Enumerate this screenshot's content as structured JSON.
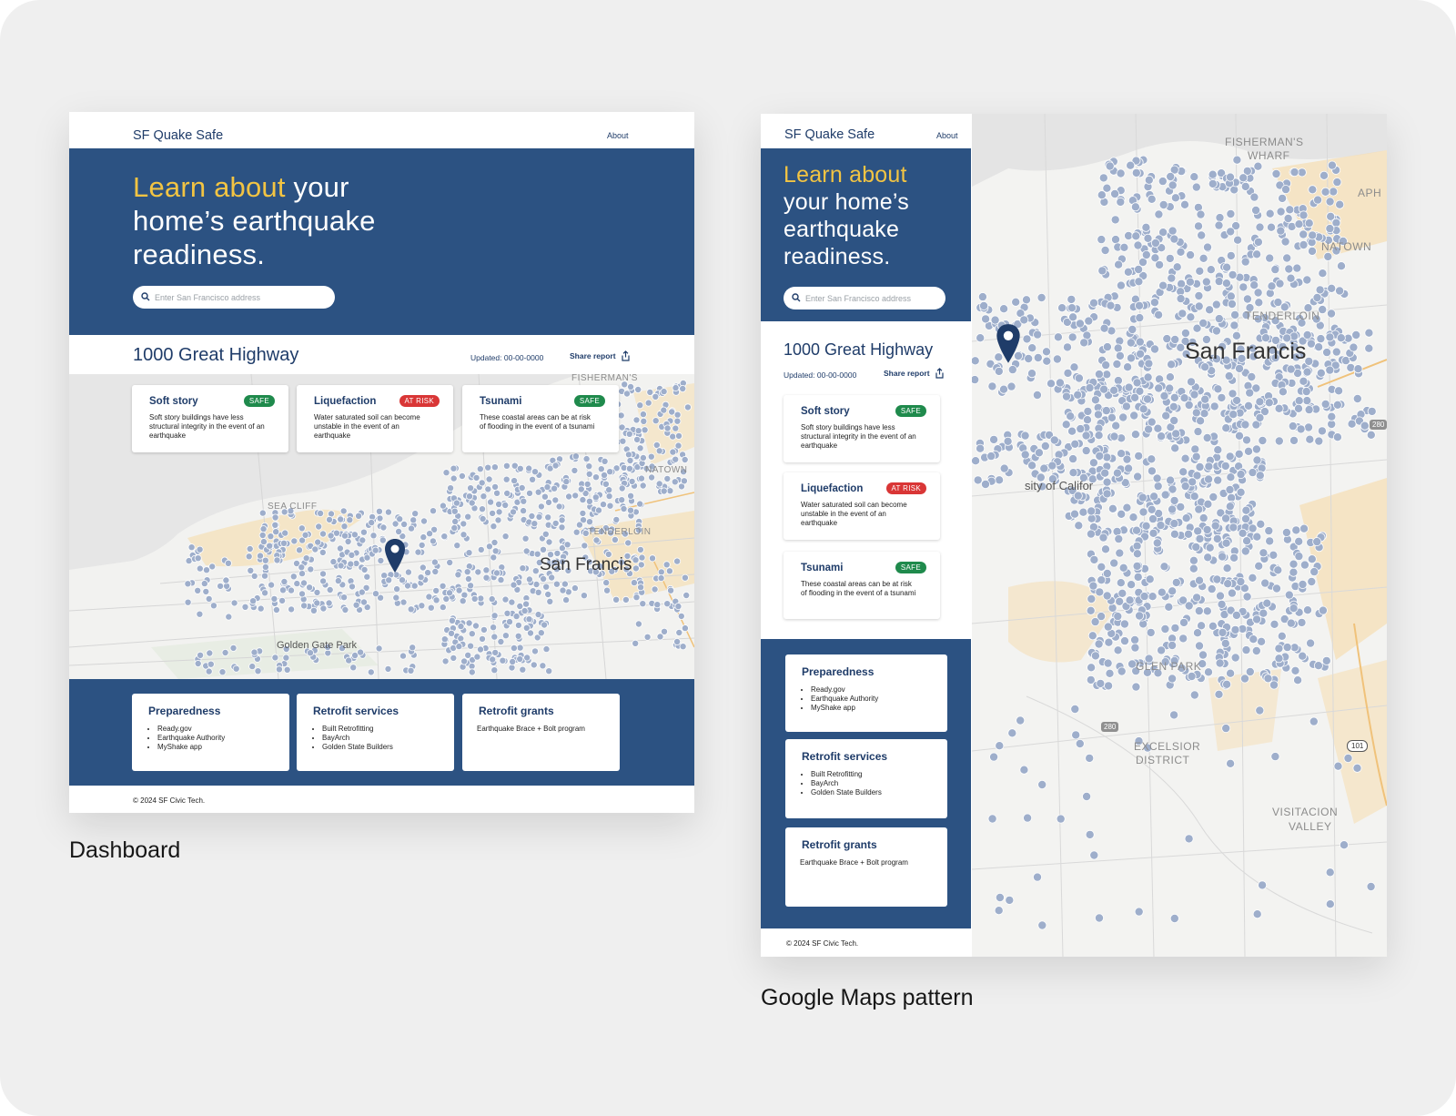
{
  "captions": {
    "left": "Dashboard",
    "right": "Google Maps pattern"
  },
  "app": {
    "brand": "SF Quake Safe",
    "nav_about": "About"
  },
  "hero": {
    "accent": "Learn about",
    "rest_inline": " your",
    "line2": "home’s earthquake",
    "line3": "readiness.",
    "stacked": [
      "your home’s",
      "earthquake",
      "readiness."
    ],
    "search_placeholder": "Enter San Francisco address"
  },
  "report": {
    "address": "1000 Great Highway",
    "updated": "Updated: 00-00-0000",
    "share": "Share report"
  },
  "hazards": [
    {
      "title": "Soft story",
      "status": "SAFE",
      "status_type": "safe",
      "description": "Soft story buildings have less structural integrity in the event of an earthquake"
    },
    {
      "title": "Liquefaction",
      "status": "AT RISK",
      "status_type": "risk",
      "description": "Water saturated soil can become unstable in the event of an earthquake"
    },
    {
      "title": "Tsunami",
      "status": "SAFE",
      "status_type": "safe",
      "description": "These coastal areas can be at risk of flooding in the event of a tsunami"
    }
  ],
  "resources": [
    {
      "title": "Preparedness",
      "items": [
        "Ready.gov",
        "Earthquake Authority",
        "MyShake app"
      ]
    },
    {
      "title": "Retrofit services",
      "items": [
        "Built Retrofitting",
        "BayArch",
        "Golden State Builders"
      ]
    },
    {
      "title": "Retrofit grants",
      "text": "Earthquake Brace + Bolt program"
    }
  ],
  "footer": "© 2024 SF Civic Tech.",
  "map_labels": {
    "a": [
      "FISHERMAN'S",
      "SEA CLIFF",
      "TENDERLOIN",
      "NATOWN",
      "Golden Gate Park",
      "San Francis"
    ],
    "b": [
      "FISHERMAN'S",
      "WHARF",
      "TENDERLOIN",
      "NATOWN",
      "San Francis",
      "sity of Califor",
      "GLEN PARK",
      "EXCELSIOR",
      "DISTRICT",
      "VISITACION",
      "VALLEY",
      "280",
      "280",
      "101",
      "APH"
    ]
  },
  "colors": {
    "navy": "#2c5282",
    "accent_yellow": "#f2c443",
    "safe_green": "#1f8a4c",
    "risk_red": "#d93636",
    "dot_blue_gray": "#9eaecb",
    "pin_navy": "#1f3c69"
  },
  "icons": [
    "search-icon",
    "share-icon",
    "location-pin-icon"
  ]
}
